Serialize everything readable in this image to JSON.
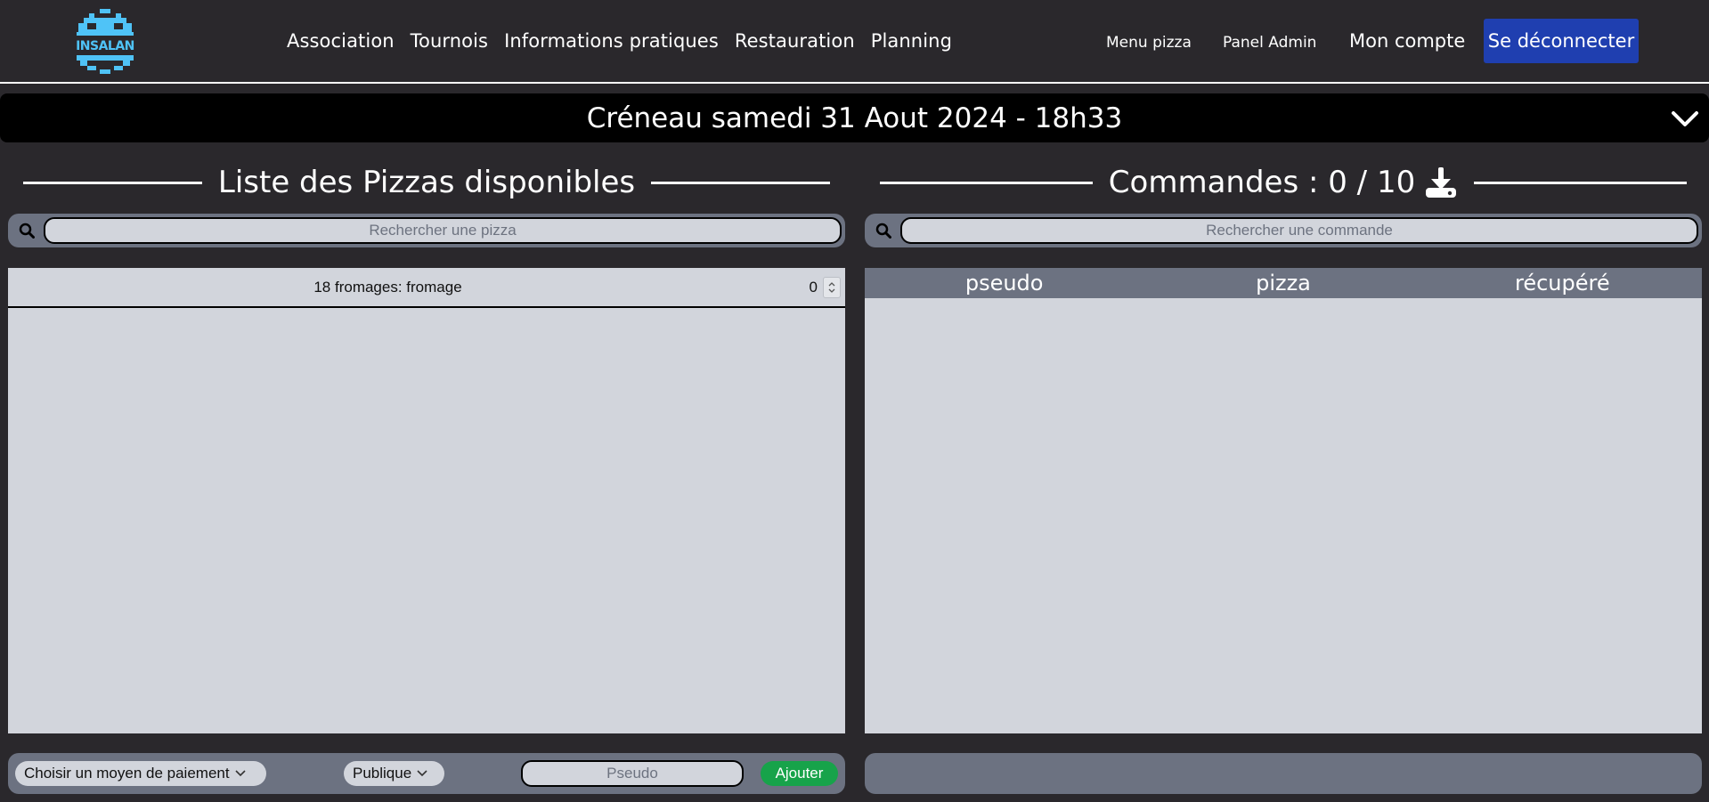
{
  "nav": {
    "logo_text": "INSALAN",
    "links": [
      "Association",
      "Tournois",
      "Informations pratiques",
      "Restauration",
      "Planning"
    ],
    "menu_pizza": "Menu pizza",
    "panel_admin": "Panel Admin",
    "account": "Mon compte",
    "logout": "Se déconnecter"
  },
  "creneau": {
    "title": "Créneau samedi 31 Aout 2024 - 18h33"
  },
  "pizzas": {
    "title": "Liste des Pizzas disponibles",
    "search_placeholder": "Rechercher une pizza",
    "items": [
      {
        "name": "18 fromages: fromage",
        "quantity": "0"
      }
    ]
  },
  "orders": {
    "title": "Commandes : 0 / 10",
    "search_placeholder": "Rechercher une commande",
    "columns": [
      "pseudo",
      "pizza",
      "récupéré"
    ],
    "rows": []
  },
  "order_form": {
    "payment_label": "Choisir un moyen de paiement",
    "visibility_label": "Publique",
    "pseudo_placeholder": "Pseudo",
    "submit_label": "Ajouter"
  },
  "colors": {
    "background": "#2a282c",
    "panel": "#d2d5dc",
    "panel_header": "#6c7281",
    "logout_button": "#1f3fb0",
    "add_button": "#17a34a",
    "logo": "#4fc3f7"
  }
}
